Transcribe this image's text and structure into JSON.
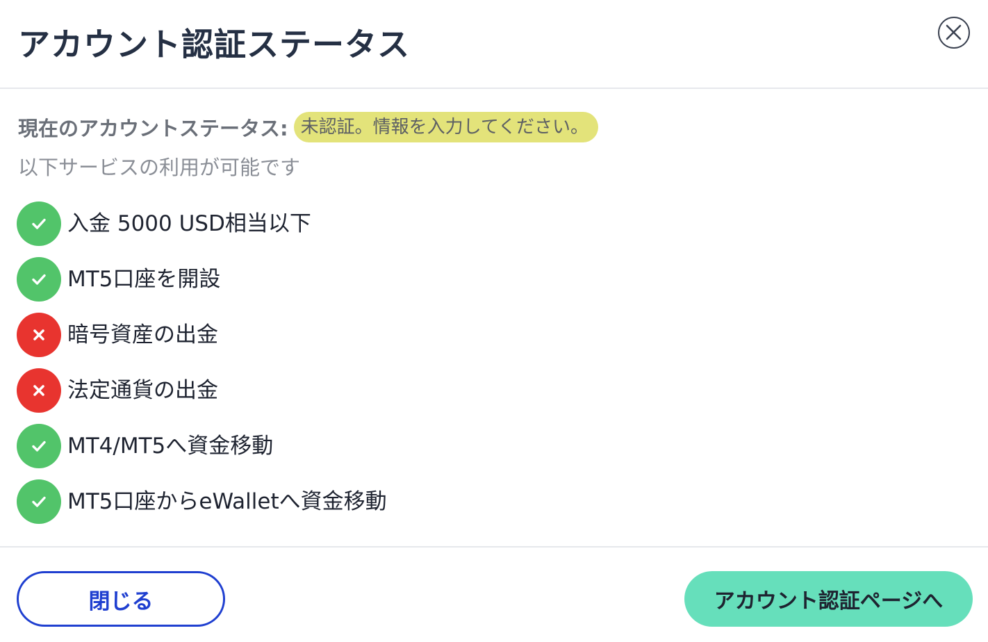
{
  "dialog": {
    "title": "アカウント認証ステータス",
    "close_icon": "close-circle-icon"
  },
  "status": {
    "label": "現在のアカウントステータス:",
    "value": "未認証。情報を入力してください。",
    "badge_color": "#e3e37a"
  },
  "available_text": "以下サービスの利用が可能です",
  "services": [
    {
      "label": "入金 5000 USD相当以下",
      "available": true
    },
    {
      "label": "MT5口座を開設",
      "available": true
    },
    {
      "label": "暗号資産の出金",
      "available": false
    },
    {
      "label": "法定通貨の出金",
      "available": false
    },
    {
      "label": "MT4/MT5へ資金移動",
      "available": true
    },
    {
      "label": "MT5口座からeWalletへ資金移動",
      "available": true
    }
  ],
  "icons": {
    "available": "check-icon",
    "unavailable": "cross-icon"
  },
  "colors": {
    "available": "#52c46a",
    "unavailable": "#e8342f",
    "primary_button": "#66dfbb",
    "secondary_button_border": "#1f3fd0"
  },
  "footer": {
    "close_label": "閉じる",
    "verify_label": "アカウント認証ページへ"
  }
}
